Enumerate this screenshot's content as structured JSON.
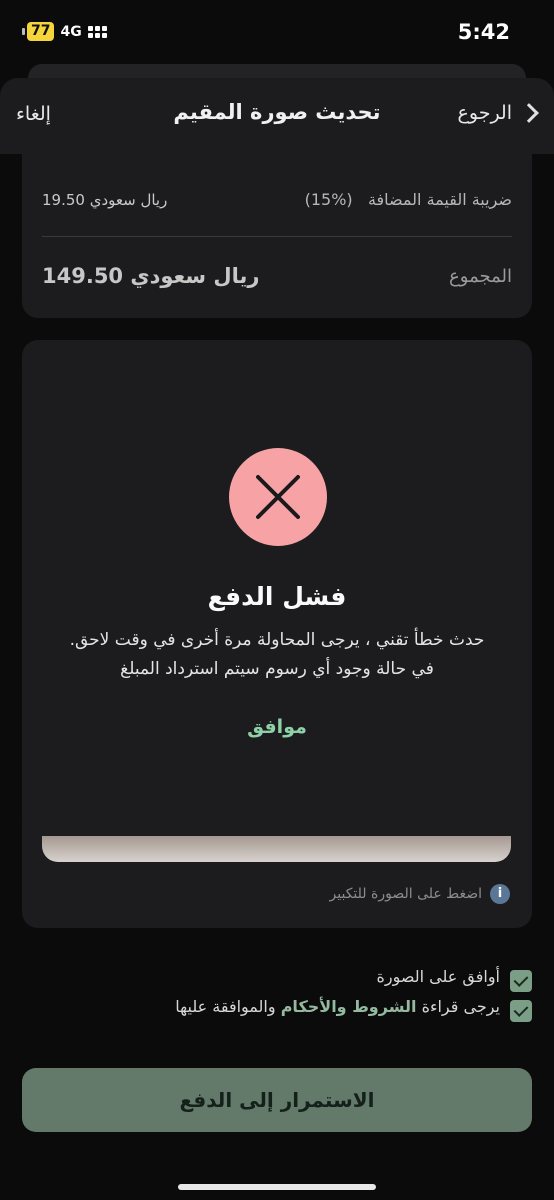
{
  "status_bar": {
    "battery": "77",
    "network": "4G",
    "time": "5:42"
  },
  "header": {
    "cancel": "إلغاء",
    "title": "تحديث صورة المقيم",
    "back": "الرجوع"
  },
  "summary": {
    "vat_label": "ضريبة القيمة المضافة",
    "vat_percent": "(15%)",
    "vat_amount": "19.50 ريال سعودي",
    "total_label": "المجموع",
    "total_amount": "149.50 ريال سعودي"
  },
  "photo_card": {
    "hint": "اضغط على الصورة للتكبير"
  },
  "modal": {
    "title": "فشل الدفع",
    "message": "حدث خطأ تقني ، يرجى المحاولة مرة أخرى في وقت لاحق. في حالة وجود أي رسوم سيتم استرداد المبلغ",
    "ok": "موافق",
    "icon_color": "#f7a3a5"
  },
  "agreements": {
    "photo_agree": "أوافق على الصورة",
    "terms_prefix": "يرجى قراءة",
    "terms_link": "الشروط والأحكام",
    "terms_suffix": "والموافقة عليها"
  },
  "continue_button": "الاستمرار إلى الدفع",
  "colors": {
    "accent": "#8fd1a6",
    "button": "#637a6b",
    "error": "#f7a3a5"
  }
}
